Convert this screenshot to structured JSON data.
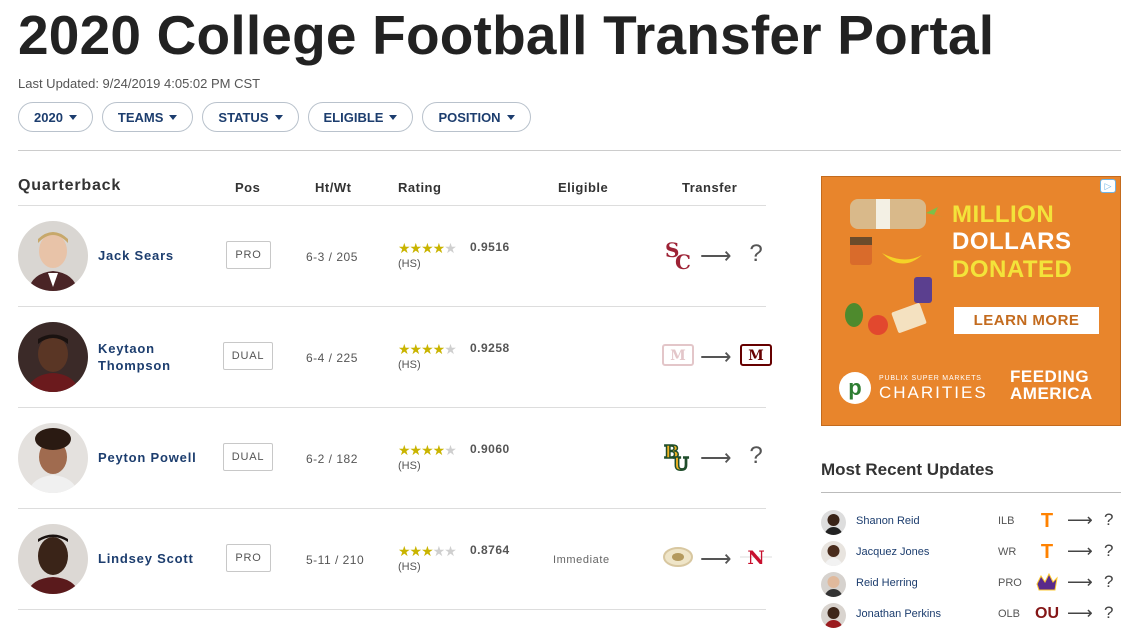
{
  "page": {
    "title": "2020 College Football Transfer Portal",
    "last_updated": "Last Updated: 9/24/2019 4:05:02 PM CST"
  },
  "filters": [
    {
      "label": "2020"
    },
    {
      "label": "TEAMS"
    },
    {
      "label": "STATUS"
    },
    {
      "label": "ELIGIBLE"
    },
    {
      "label": "POSITION"
    }
  ],
  "table": {
    "section": "Quarterback",
    "headers": {
      "pos": "Pos",
      "htwt": "Ht/Wt",
      "rating": "Rating",
      "eligible": "Eligible",
      "transfer": "Transfer"
    },
    "rows": [
      {
        "name": "Jack Sears",
        "pos": "PRO",
        "htwt": "6-3 / 205",
        "stars": 4,
        "score": "0.9516",
        "hs": "(HS)",
        "eligible": "",
        "from": "SC",
        "from_color": "#9d2235",
        "to": "?"
      },
      {
        "name": "Keytaon Thompson",
        "pos": "DUAL",
        "htwt": "6-4 / 225",
        "stars": 4,
        "score": "0.9258",
        "hs": "(HS)",
        "eligible": "",
        "from": "M",
        "from_color": "#e3c6c9",
        "to": "M",
        "to_color": "#660000"
      },
      {
        "name": "Peyton Powell",
        "pos": "DUAL",
        "htwt": "6-2 / 182",
        "stars": 4,
        "score": "0.9060",
        "hs": "(HS)",
        "eligible": "",
        "from": "BU",
        "from_color": "#1f4d2b",
        "to": "?"
      },
      {
        "name": "Lindsey Scott",
        "pos": "PRO",
        "htwt": "5-11 / 210",
        "stars": 3,
        "score": "0.8764",
        "hs": "(HS)",
        "eligible": "Immediate",
        "from": "M",
        "from_color": "#d8c7a0",
        "to": "N",
        "to_color": "#c8102e"
      }
    ]
  },
  "ad": {
    "line1": "MILLION",
    "line2": "DOLLARS",
    "line3": "DONATED",
    "cta": "LEARN MORE",
    "publix_small": "PUBLIX SUPER MARKETS",
    "publix_big": "CHARITIES",
    "feeding1": "FEEDING",
    "feeding2": "AMERICA"
  },
  "recent": {
    "title": "Most Recent Updates",
    "items": [
      {
        "name": "Shanon Reid",
        "pos": "ILB",
        "from": "T",
        "from_color": "#ff8200",
        "to": "?"
      },
      {
        "name": "Jacquez Jones",
        "pos": "WR",
        "from": "T",
        "from_color": "#ff8200",
        "to": "?"
      },
      {
        "name": "Reid Herring",
        "pos": "PRO",
        "from": "P",
        "from_color": "#592a8a",
        "to": "?"
      },
      {
        "name": "Jonathan Perkins",
        "pos": "OLB",
        "from": "OU",
        "from_color": "#841617",
        "to": "?"
      }
    ]
  }
}
